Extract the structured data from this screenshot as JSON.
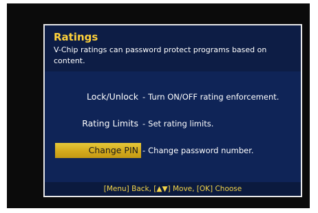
{
  "dialog": {
    "title": "Ratings",
    "description": "V-Chip ratings can password protect programs based on content."
  },
  "menu": {
    "items": [
      {
        "label": "Lock/Unlock",
        "description": "Turn ON/OFF rating enforcement.",
        "selected": false
      },
      {
        "label": "Rating Limits",
        "description": "Set rating limits.",
        "selected": false
      },
      {
        "label": "Change PIN",
        "description": "Change password number.",
        "selected": true
      }
    ],
    "separator": "-"
  },
  "footer": {
    "hint": "[Menu] Back, [▲▼] Move, [OK] Choose"
  },
  "colors": {
    "panel_background": "#0f2457",
    "title": "#ffd23a",
    "selection": "#d4aa1c",
    "footer_text": "#f3d44a"
  }
}
